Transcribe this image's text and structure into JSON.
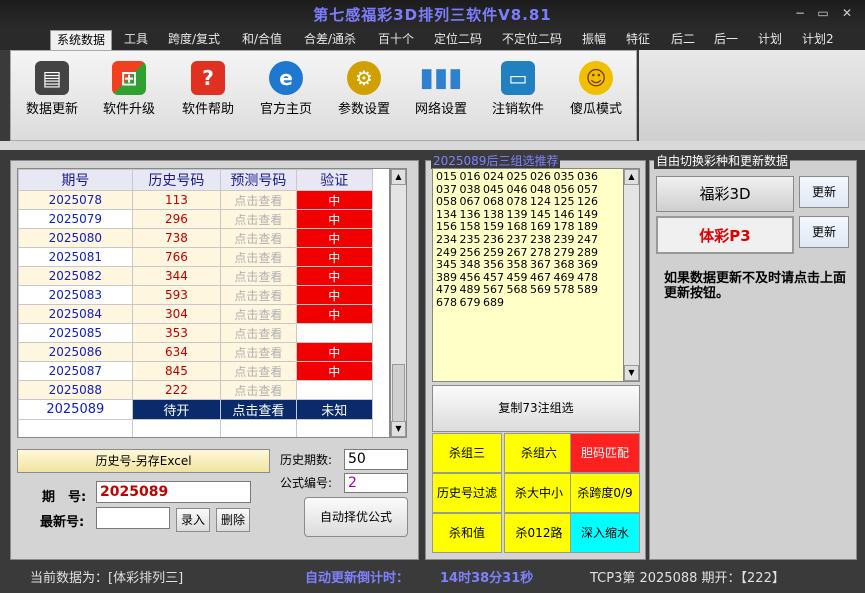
{
  "title": "第七感福彩3D排列三软件V8.81",
  "window": {
    "min": "−",
    "max": "▭",
    "close": "✕"
  },
  "menu": [
    "系统数据",
    "工具",
    "跨度/复式",
    "和/合值",
    "合差/通杀",
    "百十个",
    "定位二码",
    "不定位二码",
    "振幅",
    "特征",
    "后二",
    "后一",
    "计划",
    "计划2"
  ],
  "toolbar": [
    {
      "label": "数据更新",
      "icon": "chip-icon",
      "color": "#444444"
    },
    {
      "label": "软件升级",
      "icon": "windows-logo-icon",
      "color": "#2a7ad8"
    },
    {
      "label": "软件帮助",
      "icon": "help-icon",
      "color": "#e03020"
    },
    {
      "label": "官方主页",
      "icon": "ie-browser-icon",
      "color": "#1f78d0"
    },
    {
      "label": "参数设置",
      "icon": "gears-icon",
      "color": "#d0a000"
    },
    {
      "label": "网络设置",
      "icon": "bar-chart-icon",
      "color": "#3080d0"
    },
    {
      "label": "注销软件",
      "icon": "monitor-icon",
      "color": "#2080c0"
    },
    {
      "label": "傻瓜模式",
      "icon": "smiley-icon",
      "color": "#f0c000"
    }
  ],
  "table": {
    "headers": [
      "期号",
      "历史号码",
      "预测号码",
      "验证"
    ],
    "rows": [
      {
        "qi": "2025078",
        "his": "113",
        "pred": "点击查看",
        "ver": "中"
      },
      {
        "qi": "2025079",
        "his": "296",
        "pred": "点击查看",
        "ver": "中"
      },
      {
        "qi": "2025080",
        "his": "738",
        "pred": "点击查看",
        "ver": "中"
      },
      {
        "qi": "2025081",
        "his": "766",
        "pred": "点击查看",
        "ver": "中"
      },
      {
        "qi": "2025082",
        "his": "344",
        "pred": "点击查看",
        "ver": "中"
      },
      {
        "qi": "2025083",
        "his": "593",
        "pred": "点击查看",
        "ver": "中"
      },
      {
        "qi": "2025084",
        "his": "304",
        "pred": "点击查看",
        "ver": "中"
      },
      {
        "qi": "2025085",
        "his": "353",
        "pred": "点击查看",
        "ver": ""
      },
      {
        "qi": "2025086",
        "his": "634",
        "pred": "点击查看",
        "ver": "中"
      },
      {
        "qi": "2025087",
        "his": "845",
        "pred": "点击查看",
        "ver": "中"
      },
      {
        "qi": "2025088",
        "his": "222",
        "pred": "点击查看",
        "ver": ""
      }
    ],
    "last": {
      "qi": "2025089",
      "his": "待开",
      "pred": "点击查看",
      "ver": "未知"
    }
  },
  "left": {
    "export_btn": "历史号-另存Excel",
    "qihao_label": "期　号:",
    "qihao_value": "2025089",
    "newest_label": "最新号:",
    "newest_value": "",
    "enter_btn": "录入",
    "delete_btn": "删除",
    "hist_count_label": "历史期数:",
    "hist_count_value": "50",
    "formula_label": "公式编号:",
    "formula_value": "2",
    "auto_btn": "自动择优公式"
  },
  "middle": {
    "title": "2025089后三组选推荐",
    "numbers": "015 016 024 025 026 035 036 037 038 045 046 048 056 057 058 067 068 078 124 125 126 134 136 138 139 145 146 149 156 158 159 168 169 178 189 234 235 236 237 238 239 247 249 256 259 267 278 279 289 345 348 356 358 367 368 369 389 456 457 459 467 469 478 479 489 567 568 569 578 589 678 679 689",
    "copy_btn": "复制73注组选",
    "cells": [
      {
        "label": "杀组三",
        "style": "yellow"
      },
      {
        "label": "杀组六",
        "style": "yellow"
      },
      {
        "label": "胆码匹配",
        "style": "redc"
      },
      {
        "label": "历史号过滤",
        "style": "yellow"
      },
      {
        "label": "杀大中小",
        "style": "yellow"
      },
      {
        "label": "杀跨度0/9",
        "style": "yellow"
      },
      {
        "label": "杀和值",
        "style": "yellow"
      },
      {
        "label": "杀012路",
        "style": "yellow"
      },
      {
        "label": "深入缩水",
        "style": "cyan"
      }
    ]
  },
  "right": {
    "title": "自由切换彩种和更新数据",
    "lottery1": "福彩3D",
    "lottery2": "体彩P3",
    "update": "更新",
    "note": "如果数据更新不及时请点击上面更新按钮。"
  },
  "status": {
    "current": "当前数据为：[体彩排列三]",
    "countdown_label": "自动更新倒计时：",
    "countdown": "14时38分31秒",
    "latest": "TCP3第 2025088 期开：【222】"
  }
}
